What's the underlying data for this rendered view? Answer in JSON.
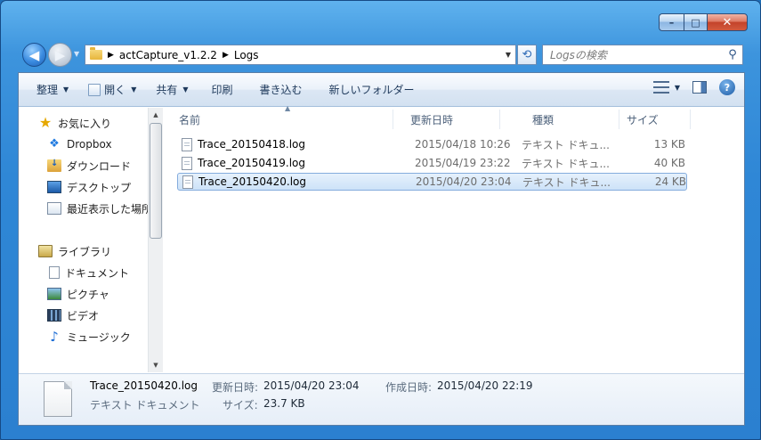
{
  "titlebar": {
    "minimize": "–",
    "maximize": "□",
    "close": "✕"
  },
  "navigation": {
    "back_icon": "arrow-left",
    "forward_icon": "arrow-right",
    "address": {
      "root": "actCapture_v1.2.2",
      "current": "Logs"
    },
    "search_placeholder": "Logsの検索"
  },
  "toolbar": {
    "organize": "整理",
    "open": "開く",
    "share": "共有",
    "print": "印刷",
    "burn": "書き込む",
    "new_folder": "新しいフォルダー"
  },
  "sidebar": {
    "favorites": {
      "label": "お気に入り",
      "items": [
        {
          "label": "Dropbox",
          "icon": "dropbox-icon"
        },
        {
          "label": "ダウンロード",
          "icon": "downloads-icon"
        },
        {
          "label": "デスクトップ",
          "icon": "desktop-icon"
        },
        {
          "label": "最近表示した場所",
          "icon": "recent-places-icon"
        }
      ]
    },
    "libraries": {
      "label": "ライブラリ",
      "items": [
        {
          "label": "ドキュメント",
          "icon": "documents-icon"
        },
        {
          "label": "ピクチャ",
          "icon": "pictures-icon"
        },
        {
          "label": "ビデオ",
          "icon": "videos-icon"
        },
        {
          "label": "ミュージック",
          "icon": "music-icon"
        }
      ]
    }
  },
  "columns": {
    "name": "名前",
    "modified": "更新日時",
    "type": "種類",
    "size": "サイズ"
  },
  "files": [
    {
      "name": "Trace_20150418.log",
      "modified": "2015/04/18 10:26",
      "type": "テキスト ドキュ...",
      "size": "13 KB",
      "selected": false
    },
    {
      "name": "Trace_20150419.log",
      "modified": "2015/04/19 23:22",
      "type": "テキスト ドキュ...",
      "size": "40 KB",
      "selected": false
    },
    {
      "name": "Trace_20150420.log",
      "modified": "2015/04/20 23:04",
      "type": "テキスト ドキュ...",
      "size": "24 KB",
      "selected": true
    }
  ],
  "details": {
    "name": "Trace_20150420.log",
    "type": "テキスト ドキュメント",
    "modified_label": "更新日時:",
    "modified": "2015/04/20 23:04",
    "created_label": "作成日時:",
    "created": "2015/04/20 22:19",
    "size_label": "サイズ:",
    "size": "23.7 KB"
  }
}
